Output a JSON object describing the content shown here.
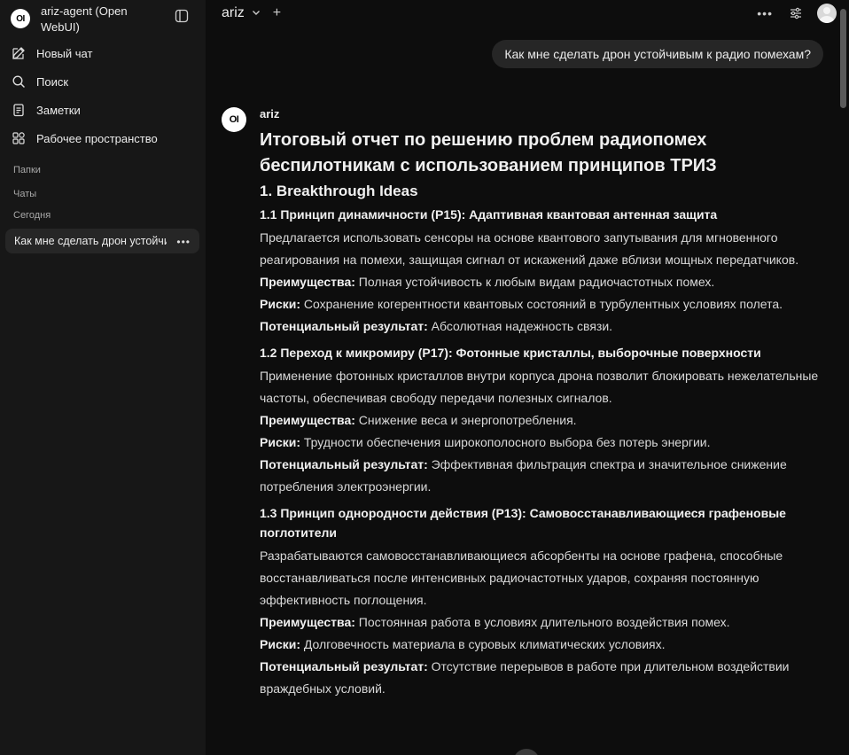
{
  "sidebar": {
    "brand_logo": "OI",
    "brand_title": "ariz-agent (Open WebUI)",
    "nav": [
      {
        "label": "Новый чат",
        "icon": "pencil-icon"
      },
      {
        "label": "Поиск",
        "icon": "search-icon"
      },
      {
        "label": "Заметки",
        "icon": "notes-icon"
      },
      {
        "label": "Рабочее пространство",
        "icon": "workspace-icon"
      }
    ],
    "folders_label": "Папки",
    "chats_label": "Чаты",
    "today_label": "Сегодня",
    "chat_item": "Как мне сделать дрон устойчивым к радио помехам?",
    "chat_item_more": "•••"
  },
  "topbar": {
    "model": "ariz",
    "chevron": "⌄",
    "plus": "+",
    "dots": "•••"
  },
  "user_message": "Как мне сделать дрон устойчивым к радио помехам?",
  "assistant": {
    "logo": "OI",
    "name": "ariz",
    "title": "Итоговый отчет по решению проблем радиопомех беспилотникам с использованием принципов ТРИЗ",
    "section": "1. Breakthrough Ideas",
    "ideas": [
      {
        "heading": "1.1 Принцип динамичности (P15): Адаптивная квантовая антенная защита",
        "description": "Предлагается использовать сенсоры на основе квантового запутывания для мгновенного реагирования на помехи, защищая сигнал от искажений даже вблизи мощных передатчиков.",
        "adv_label": "Преимущества:",
        "adv": "Полная устойчивость к любым видам радиочастотных помех.",
        "risk_label": "Риски:",
        "risk": "Сохранение когерентности квантовых состояний в турбулентных условиях полета.",
        "result_label": "Потенциальный результат:",
        "result": "Абсолютная надежность связи."
      },
      {
        "heading": "1.2 Переход к микромиру (P17): Фотонные кристаллы, выборочные поверхности",
        "description": "Применение фотонных кристаллов внутри корпуса дрона позволит блокировать нежелательные частоты, обеспечивая свободу передачи полезных сигналов.",
        "adv_label": "Преимущества:",
        "adv": "Снижение веса и энергопотребления.",
        "risk_label": "Риски:",
        "risk": "Трудности обеспечения широкополосного выбора без потерь энергии.",
        "result_label": "Потенциальный результат:",
        "result": "Эффективная фильтрация спектра и значительное снижение потребления электроэнергии."
      },
      {
        "heading": "1.3 Принцип однородности действия (P13): Самовосстанавливающиеся графеновые поглотители",
        "description": "Разрабатываются самовосстанавливающиеся абсорбенты на основе графена, способные восстанавливаться после интенсивных радиочастотных ударов, сохраняя постоянную эффективность поглощения.",
        "adv_label": "Преимущества:",
        "adv": "Постоянная работа в условиях длительного воздействия помех.",
        "risk_label": "Риски:",
        "risk": "Долговечность материала в суровых климатических условиях.",
        "result_label": "Потенциальный результат:",
        "result": "Отсутствие перерывов в работе при длительном воздействии враждебных условий."
      }
    ]
  }
}
